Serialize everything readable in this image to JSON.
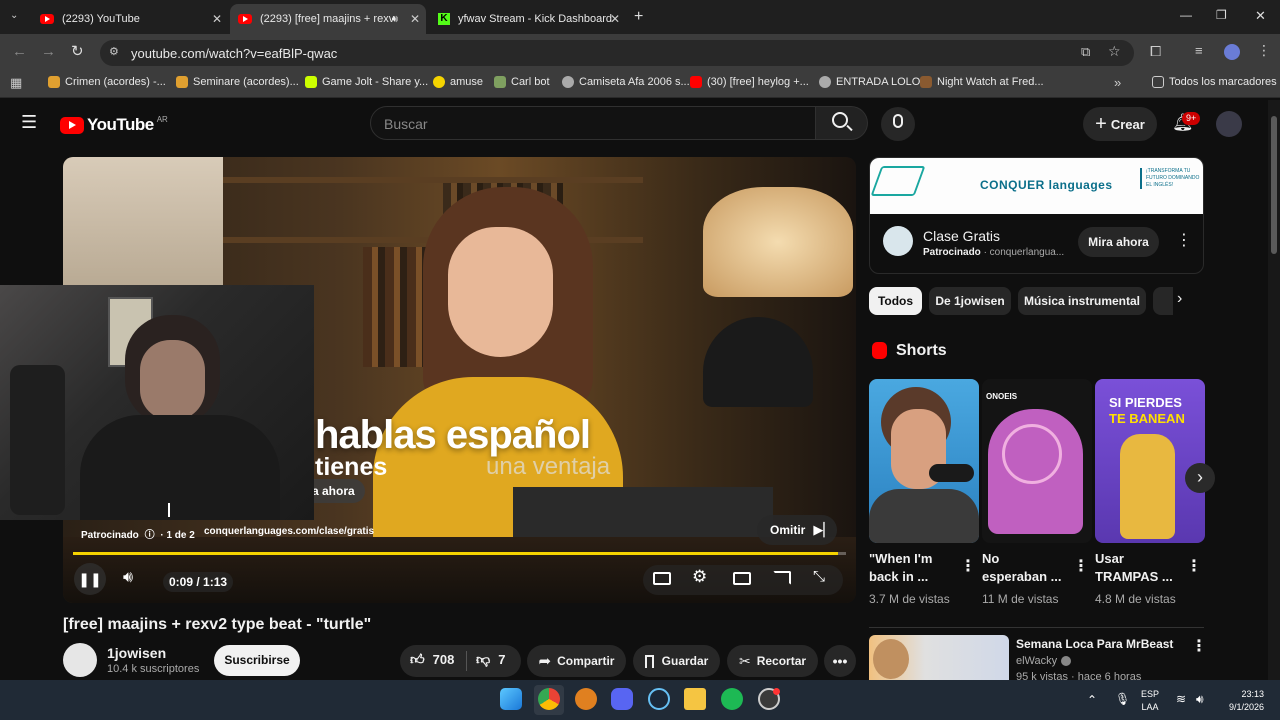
{
  "browser": {
    "tabs": [
      {
        "title": "(2293) YouTube"
      },
      {
        "title": "(2293) [free] maajins + rexv"
      },
      {
        "title": "yfwav Stream - Kick Dashboard"
      }
    ],
    "url": "youtube.com/watch?v=eafBlP-qwac",
    "bookmarks": [
      "Crimen (acordes) -...",
      "Seminare (acordes)...",
      "Game Jolt - Share y...",
      "amuse",
      "Carl bot",
      "Camiseta Afa 2006 s...",
      "(30) [free] heylog +...",
      "ENTRADA LOLO",
      "Night Watch at Fred..."
    ],
    "all_bookmarks": "Todos los marcadores"
  },
  "youtube": {
    "logo": "YouTube",
    "region": "AR",
    "search_placeholder": "Buscar",
    "create_label": "Crear",
    "notif_count": "9+"
  },
  "player": {
    "overlay_big": "hablas español",
    "overlay_line2": "tienes",
    "overlay_line3": "una ventaja",
    "mira_ahora": "a ahora",
    "sponsored": "Patrocinado",
    "ad_count": "· 1 de 2",
    "ad_url": "conquerlanguages.com/clase/gratis",
    "skip": "Omitir",
    "time": "0:09 / 1:13",
    "progress": 0.99
  },
  "video": {
    "title": "[free] maajins + rexv2 type beat - \"turtle\"",
    "channel": "1jowisen",
    "subs": "10.4 k suscriptores",
    "subscribe": "Suscribirse",
    "likes": "708",
    "dislikes": "7",
    "share": "Compartir",
    "save": "Guardar",
    "clip": "Recortar"
  },
  "ad_card": {
    "brand": "CONQUER languages",
    "slogan": "¡TRANSFORMA TU FUTURO DOMINANDO EL INGLÉS!",
    "title": "Clase Gratis",
    "sponsored": "Patrocinado",
    "domain": "· conquerlangua...",
    "cta": "Mira ahora"
  },
  "chips": [
    "Todos",
    "De 1jowisen",
    "Música instrumental"
  ],
  "shorts": {
    "heading": "Shorts",
    "items": [
      {
        "title1": "\"When I'm",
        "title2": "back in ...",
        "views": "3.7 M de vistas"
      },
      {
        "title1": "No",
        "title2": "esperaban ...",
        "views": "11 M de vistas"
      },
      {
        "title1": "Usar",
        "title2": "TRAMPAS ...",
        "views": "4.8 M de vistas"
      }
    ],
    "thumb3_text1": "SI PIERDES",
    "thumb3_text2": "TE BANEAN",
    "thumb2_text": "ONOEIS"
  },
  "next_video": {
    "title": "Semana Loca Para MrBeast",
    "channel": "elWacky",
    "meta": "95 k vistas · hace 6 horas"
  },
  "taskbar": {
    "lang": "ESP",
    "lang2": "LAA",
    "time": "23:13",
    "date": "9/1/2026"
  }
}
